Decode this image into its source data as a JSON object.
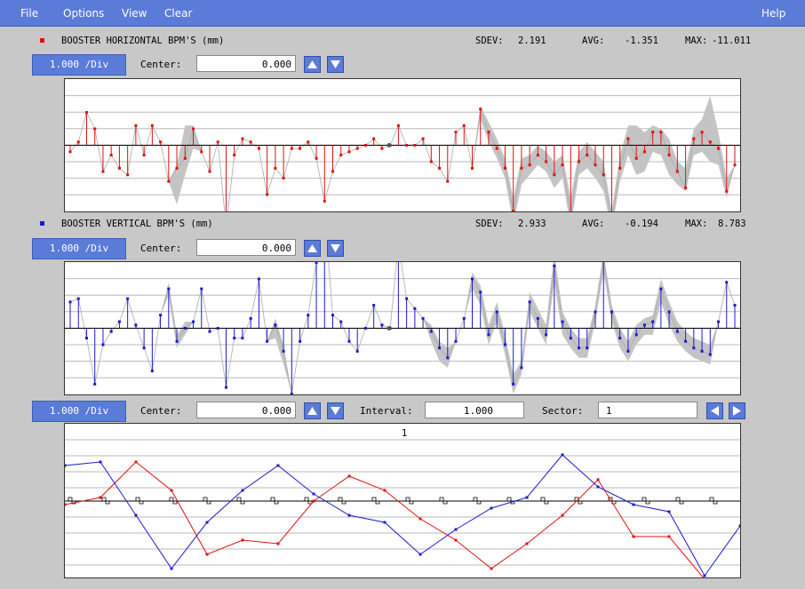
{
  "menu": {
    "file": "File",
    "options": "Options",
    "view": "View",
    "clear": "Clear",
    "help": "Help"
  },
  "colors": {
    "menu_bg": "#5b7bd8",
    "horizontal": "#e01010",
    "vertical": "#1a1ad0",
    "envelope": "#c4c4c4"
  },
  "horizontal": {
    "title": "BOOSTER HORIZONTAL BPM'S (mm)",
    "sdev_label": "SDEV:",
    "sdev": "2.191",
    "avg_label": "AVG:",
    "avg": "-1.351",
    "max_label": "MAX:",
    "max": "-11.011",
    "div": "1.000 /Div",
    "center_label": "Center:",
    "center": "0.000",
    "values": [
      -0.2,
      0.1,
      1.0,
      0.5,
      -0.8,
      -0.3,
      -0.7,
      -0.9,
      0.6,
      -0.3,
      0.6,
      0.1,
      -1.1,
      -0.7,
      -0.4,
      0.5,
      -0.2,
      -0.8,
      0.1,
      -2.5,
      -0.3,
      0.2,
      0.1,
      -0.1,
      -1.5,
      -0.7,
      -1.0,
      -0.1,
      -0.1,
      0.1,
      -0.4,
      -1.7,
      -0.8,
      -0.3,
      -0.2,
      -0.1,
      0.0,
      0.2,
      -0.1,
      0.0,
      0.6,
      0.0,
      0.0,
      0.2,
      -0.5,
      -0.7,
      -1.1,
      0.4,
      0.6,
      -0.7,
      1.1,
      0.4,
      -0.1,
      -0.7,
      -2.0,
      -0.7,
      -0.6,
      -0.3,
      -0.5,
      -0.9,
      -0.6,
      -2.1,
      -0.5,
      -0.3,
      -0.6,
      -0.9,
      -2.3,
      -0.7,
      0.2,
      -0.4,
      -0.2,
      0.4,
      0.4,
      -0.3,
      -0.8,
      -1.3,
      0.2,
      0.4,
      0.1,
      -0.1,
      -1.4,
      -0.6
    ],
    "env_low": [
      -0.2,
      0.1,
      1.0,
      0.5,
      -0.8,
      -0.3,
      -0.7,
      -0.9,
      0.6,
      -0.3,
      0.6,
      0.1,
      -1.1,
      -1.8,
      -0.9,
      -0.1,
      -0.2,
      -0.8,
      0.1,
      -2.5,
      -0.3,
      0.2,
      0.1,
      -0.1,
      -1.5,
      -0.7,
      -1.0,
      -0.1,
      -0.1,
      0.1,
      -0.4,
      -1.7,
      -0.8,
      -0.3,
      -0.2,
      -0.1,
      0.0,
      0.2,
      -0.1,
      0.0,
      0.6,
      0.0,
      0.0,
      0.2,
      -0.5,
      -0.7,
      -1.1,
      0.4,
      0.6,
      -0.7,
      0.8,
      0.1,
      -0.4,
      -1.0,
      -2.4,
      -1.2,
      -0.9,
      -0.6,
      -0.8,
      -1.3,
      -1.0,
      -2.5,
      -0.9,
      -0.7,
      -1.0,
      -1.4,
      -2.6,
      -1.1,
      -0.3,
      -0.9,
      -0.8,
      -0.2,
      -0.3,
      -0.9,
      -1.2,
      -1.4,
      -0.3,
      -0.2,
      -0.5,
      -0.6,
      -1.6,
      -0.6
    ],
    "env_high": [
      -0.2,
      0.1,
      1.0,
      0.5,
      -0.8,
      -0.3,
      -0.7,
      -0.9,
      0.6,
      -0.3,
      0.6,
      0.1,
      -1.1,
      -0.6,
      0.6,
      0.6,
      -0.2,
      -0.8,
      0.1,
      -2.5,
      -0.3,
      0.2,
      0.1,
      -0.1,
      -1.5,
      -0.7,
      -1.0,
      -0.1,
      -0.1,
      0.1,
      -0.4,
      -1.7,
      -0.8,
      -0.3,
      -0.2,
      -0.1,
      0.0,
      0.2,
      -0.1,
      0.0,
      0.6,
      0.0,
      0.0,
      0.2,
      -0.5,
      -0.7,
      -1.1,
      0.4,
      0.6,
      -0.7,
      1.2,
      0.7,
      0.2,
      -0.4,
      -1.6,
      -0.4,
      -0.3,
      0.0,
      -0.2,
      -0.5,
      -0.3,
      -1.6,
      -0.2,
      0.1,
      -0.2,
      -0.5,
      -2.0,
      -0.3,
      0.6,
      0.6,
      0.4,
      0.6,
      0.5,
      0.2,
      -0.5,
      -0.7,
      0.5,
      0.8,
      1.5,
      0.4,
      -1.0,
      -0.6
    ]
  },
  "vertical": {
    "title": "BOOSTER VERTICAL BPM'S (mm)",
    "sdev_label": "SDEV:",
    "sdev": "2.933",
    "avg_label": "AVG:",
    "avg": "-0.194",
    "max_label": "MAX:",
    "max": "8.783",
    "div": "1.000 /Div",
    "center_label": "Center:",
    "center": "0.000",
    "values": [
      0.8,
      0.9,
      -0.3,
      -1.7,
      -0.5,
      -0.1,
      0.2,
      0.9,
      0.1,
      -0.6,
      -1.3,
      0.4,
      1.2,
      -0.4,
      0.0,
      0.2,
      1.2,
      -0.1,
      0.0,
      -1.8,
      -0.3,
      -0.3,
      0.3,
      1.5,
      -0.4,
      0.1,
      -0.7,
      -2.0,
      -0.4,
      0.4,
      2.0,
      3.5,
      0.4,
      0.2,
      -0.4,
      -0.7,
      0.0,
      0.7,
      0.1,
      0.0,
      2.6,
      0.9,
      0.6,
      0.3,
      -0.1,
      -0.6,
      -0.9,
      -0.4,
      0.3,
      1.5,
      1.1,
      -0.2,
      0.5,
      -0.5,
      -1.7,
      -1.2,
      0.8,
      0.3,
      -0.2,
      1.9,
      0.2,
      -0.3,
      -0.6,
      -0.6,
      0.5,
      2.1,
      0.5,
      -0.3,
      -0.7,
      -0.2,
      0.1,
      0.2,
      1.2,
      0.5,
      -0.1,
      -0.4,
      -0.6,
      -0.7,
      -0.8,
      0.2,
      1.4,
      0.7
    ],
    "env_low": [
      0.8,
      0.9,
      -0.3,
      -1.7,
      -0.5,
      -0.1,
      0.2,
      0.9,
      0.1,
      -0.6,
      -1.3,
      0.4,
      1.0,
      -0.6,
      -0.2,
      0.2,
      1.2,
      -0.1,
      0.0,
      -1.8,
      -0.3,
      -0.3,
      0.3,
      1.5,
      -0.4,
      -0.3,
      -1.1,
      -2.0,
      -0.4,
      0.4,
      2.0,
      3.5,
      0.4,
      0.2,
      -0.4,
      -0.7,
      0.0,
      0.7,
      0.1,
      0.0,
      2.6,
      0.9,
      0.6,
      0.3,
      -0.4,
      -1.0,
      -1.2,
      -0.4,
      0.3,
      1.2,
      0.7,
      -0.5,
      0.2,
      -0.8,
      -2.0,
      -1.4,
      0.5,
      0.0,
      -0.5,
      1.4,
      -0.2,
      -0.6,
      -0.9,
      -0.9,
      0.2,
      1.7,
      0.2,
      -0.6,
      -1.0,
      -0.5,
      -0.2,
      -0.2,
      0.8,
      0.1,
      -0.4,
      -0.7,
      -0.9,
      -1.0,
      -1.1,
      0.2,
      1.4,
      0.7
    ],
    "env_high": [
      0.8,
      0.9,
      -0.3,
      -1.7,
      -0.5,
      -0.1,
      0.2,
      0.9,
      0.1,
      -0.6,
      -1.3,
      0.4,
      1.4,
      -0.2,
      0.2,
      0.2,
      1.2,
      -0.1,
      0.0,
      -1.8,
      -0.3,
      -0.3,
      0.3,
      1.5,
      -0.4,
      0.3,
      -0.5,
      -2.0,
      -0.4,
      0.4,
      2.0,
      3.5,
      0.4,
      0.2,
      -0.4,
      -0.7,
      0.0,
      0.7,
      0.1,
      0.0,
      2.6,
      0.9,
      0.6,
      0.3,
      0.1,
      -0.4,
      -0.6,
      -0.4,
      0.3,
      1.7,
      1.3,
      0.1,
      0.8,
      -0.2,
      -1.4,
      -1.0,
      1.1,
      0.6,
      0.1,
      2.3,
      0.5,
      0.0,
      -0.3,
      -0.3,
      0.7,
      2.3,
      0.7,
      0.0,
      -0.4,
      0.1,
      0.3,
      0.4,
      1.5,
      0.8,
      0.2,
      -0.1,
      -0.3,
      -0.4,
      -0.5,
      0.2,
      1.4,
      0.7
    ]
  },
  "sector": {
    "div": "1.000 /Div",
    "center_label": "Center:",
    "center": "0.000",
    "interval_label": "Interval:",
    "interval": "1.000",
    "sector_label": "Sector:",
    "sector": "1",
    "plot_label": "1",
    "red": [
      -0.1,
      0.1,
      1.1,
      0.3,
      -1.5,
      -1.1,
      -1.2,
      0.0,
      0.7,
      0.3,
      -0.5,
      -1.1,
      -1.9,
      -1.2,
      -0.4,
      0.6,
      -1.0,
      -1.0,
      -2.2,
      -2.3
    ],
    "blue": [
      1.0,
      1.1,
      -0.4,
      -1.9,
      -0.6,
      0.3,
      1.0,
      0.2,
      -0.4,
      -0.6,
      -1.5,
      -0.8,
      -0.2,
      0.1,
      1.3,
      0.4,
      -0.1,
      -0.3,
      -2.1,
      -0.7
    ]
  }
}
